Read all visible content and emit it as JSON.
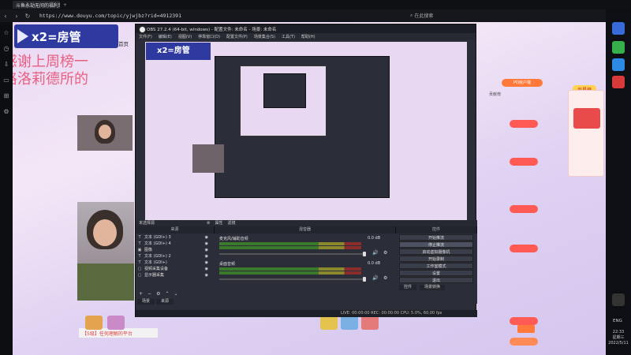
{
  "browser": {
    "tab_title": "斗鱼永劫无间的福利掌",
    "url": "https://www.douyu.com/topic/yjwjbz?rid=4912391",
    "search_label": "在此搜索"
  },
  "page": {
    "logo_text": "x2=房管",
    "home_label": "首页",
    "overlay_line1": "感谢上周榜一",
    "overlay_line2": "格洛莉德所的",
    "footer_text": "【5级】任何理解的平台",
    "side_badge": "PO房户端",
    "rank_label": "贡献榜",
    "banner_text": "周星榜"
  },
  "obs": {
    "title": "OBS 27.2.4 (64-bit, windows) - 配置文件: 未命名 - 场景: 未命名",
    "menu": [
      "文件(F)",
      "编辑(E)",
      "视图(V)",
      "停靠窗口(D)",
      "配置文件(P)",
      "场景集合(S)",
      "工具(T)",
      "帮助(H)"
    ],
    "docks": {
      "scenes_header": "来源",
      "mixer_header": "混音器",
      "controls_header": "控件",
      "no_source_label": "未选择源",
      "properties_label": "属性",
      "filters_label": "滤镜"
    },
    "sources": [
      {
        "icon": "T",
        "label": "文本 (GDI+) 3"
      },
      {
        "icon": "T",
        "label": "文本 (GDI+) 4"
      },
      {
        "icon": "▣",
        "label": "图像"
      },
      {
        "icon": "T",
        "label": "文本 (GDI+) 2"
      },
      {
        "icon": "T",
        "label": "文本 (GDI+)"
      },
      {
        "icon": "▢",
        "label": "视频采集设备"
      },
      {
        "icon": "▢",
        "label": "显示器采集"
      }
    ],
    "mixer_channels": [
      {
        "name": "麦克风/辅助音频",
        "level": "0.0 dB"
      },
      {
        "name": "桌面音频",
        "level": "0.0 dB"
      }
    ],
    "controls": [
      "开始推流",
      "停止推流",
      "启动虚拟摄像机",
      "开始录制",
      "工作室模式",
      "设置",
      "退出"
    ],
    "scene_tabs": [
      "场景",
      "来源"
    ],
    "transition_tabs": [
      "控件",
      "场景转换"
    ],
    "status": "LIVE: 00:00:00   REC: 00:00:00   CPU: 5.0%, 60.00 fps"
  },
  "system": {
    "lang": "ENG",
    "time": "22:33",
    "weekday": "星期三",
    "date": "2022/5/11"
  }
}
